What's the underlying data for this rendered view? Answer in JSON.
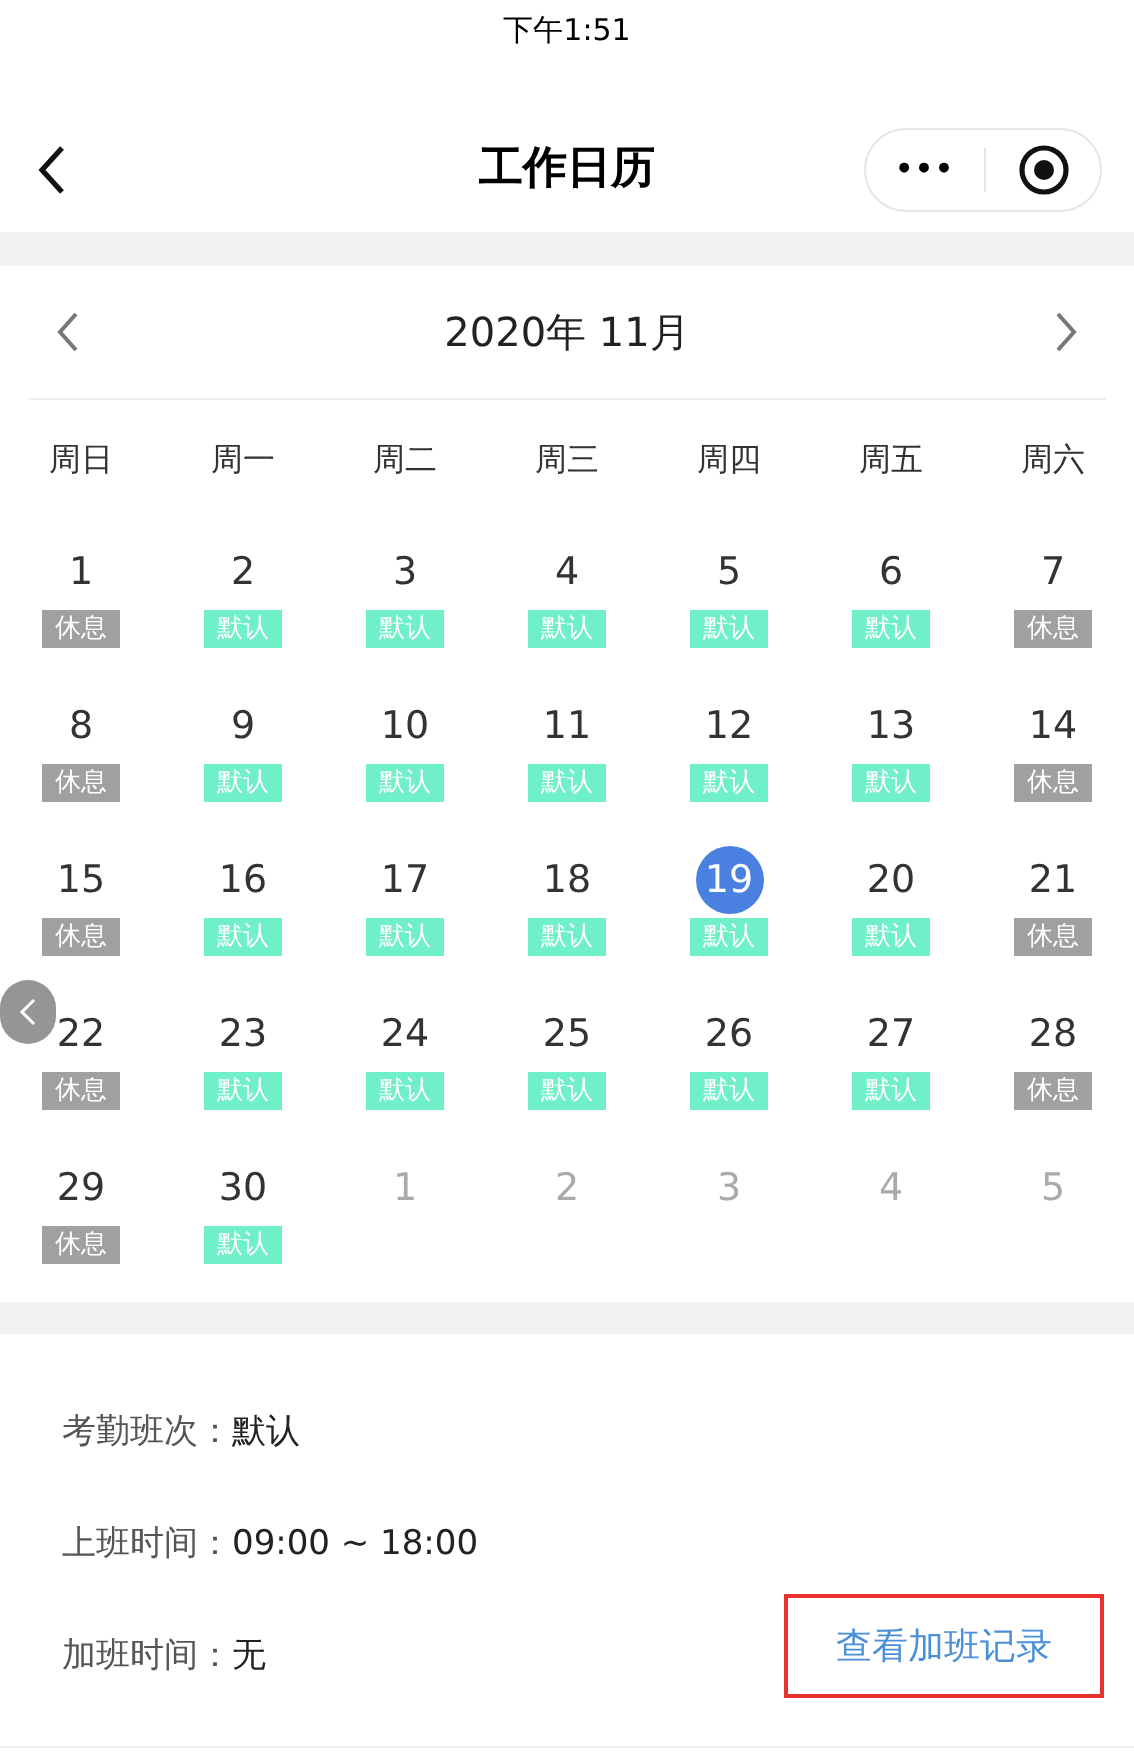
{
  "status_bar": {
    "time": "下午1:51"
  },
  "nav": {
    "title": "工作日历",
    "more": "•••"
  },
  "calendar": {
    "month": "2020年 11月",
    "weekdays": [
      "周日",
      "周一",
      "周二",
      "周三",
      "周四",
      "周五",
      "周六"
    ],
    "days": [
      {
        "day": "1",
        "tag": "休息",
        "kind": "rest",
        "other_month": false,
        "selected": false
      },
      {
        "day": "2",
        "tag": "默认",
        "kind": "work",
        "other_month": false,
        "selected": false
      },
      {
        "day": "3",
        "tag": "默认",
        "kind": "work",
        "other_month": false,
        "selected": false
      },
      {
        "day": "4",
        "tag": "默认",
        "kind": "work",
        "other_month": false,
        "selected": false
      },
      {
        "day": "5",
        "tag": "默认",
        "kind": "work",
        "other_month": false,
        "selected": false
      },
      {
        "day": "6",
        "tag": "默认",
        "kind": "work",
        "other_month": false,
        "selected": false
      },
      {
        "day": "7",
        "tag": "休息",
        "kind": "rest",
        "other_month": false,
        "selected": false
      },
      {
        "day": "8",
        "tag": "休息",
        "kind": "rest",
        "other_month": false,
        "selected": false
      },
      {
        "day": "9",
        "tag": "默认",
        "kind": "work",
        "other_month": false,
        "selected": false
      },
      {
        "day": "10",
        "tag": "默认",
        "kind": "work",
        "other_month": false,
        "selected": false
      },
      {
        "day": "11",
        "tag": "默认",
        "kind": "work",
        "other_month": false,
        "selected": false
      },
      {
        "day": "12",
        "tag": "默认",
        "kind": "work",
        "other_month": false,
        "selected": false
      },
      {
        "day": "13",
        "tag": "默认",
        "kind": "work",
        "other_month": false,
        "selected": false
      },
      {
        "day": "14",
        "tag": "休息",
        "kind": "rest",
        "other_month": false,
        "selected": false
      },
      {
        "day": "15",
        "tag": "休息",
        "kind": "rest",
        "other_month": false,
        "selected": false
      },
      {
        "day": "16",
        "tag": "默认",
        "kind": "work",
        "other_month": false,
        "selected": false
      },
      {
        "day": "17",
        "tag": "默认",
        "kind": "work",
        "other_month": false,
        "selected": false
      },
      {
        "day": "18",
        "tag": "默认",
        "kind": "work",
        "other_month": false,
        "selected": false
      },
      {
        "day": "19",
        "tag": "默认",
        "kind": "work",
        "other_month": false,
        "selected": true
      },
      {
        "day": "20",
        "tag": "默认",
        "kind": "work",
        "other_month": false,
        "selected": false
      },
      {
        "day": "21",
        "tag": "休息",
        "kind": "rest",
        "other_month": false,
        "selected": false
      },
      {
        "day": "22",
        "tag": "休息",
        "kind": "rest",
        "other_month": false,
        "selected": false
      },
      {
        "day": "23",
        "tag": "默认",
        "kind": "work",
        "other_month": false,
        "selected": false
      },
      {
        "day": "24",
        "tag": "默认",
        "kind": "work",
        "other_month": false,
        "selected": false
      },
      {
        "day": "25",
        "tag": "默认",
        "kind": "work",
        "other_month": false,
        "selected": false
      },
      {
        "day": "26",
        "tag": "默认",
        "kind": "work",
        "other_month": false,
        "selected": false
      },
      {
        "day": "27",
        "tag": "默认",
        "kind": "work",
        "other_month": false,
        "selected": false
      },
      {
        "day": "28",
        "tag": "休息",
        "kind": "rest",
        "other_month": false,
        "selected": false
      },
      {
        "day": "29",
        "tag": "休息",
        "kind": "rest",
        "other_month": false,
        "selected": false
      },
      {
        "day": "30",
        "tag": "默认",
        "kind": "work",
        "other_month": false,
        "selected": false
      },
      {
        "day": "1",
        "other_month": true,
        "selected": false
      },
      {
        "day": "2",
        "other_month": true,
        "selected": false
      },
      {
        "day": "3",
        "other_month": true,
        "selected": false
      },
      {
        "day": "4",
        "other_month": true,
        "selected": false
      },
      {
        "day": "5",
        "other_month": true,
        "selected": false
      }
    ]
  },
  "details": [
    {
      "label": "考勤班次：",
      "value": "默认"
    },
    {
      "label": "上班时间：",
      "value": "09:00 ~ 18:00"
    },
    {
      "label": "加班时间：",
      "value": "无"
    }
  ],
  "overtime_link": {
    "label": "查看加班记录",
    "highlighted": true
  }
}
